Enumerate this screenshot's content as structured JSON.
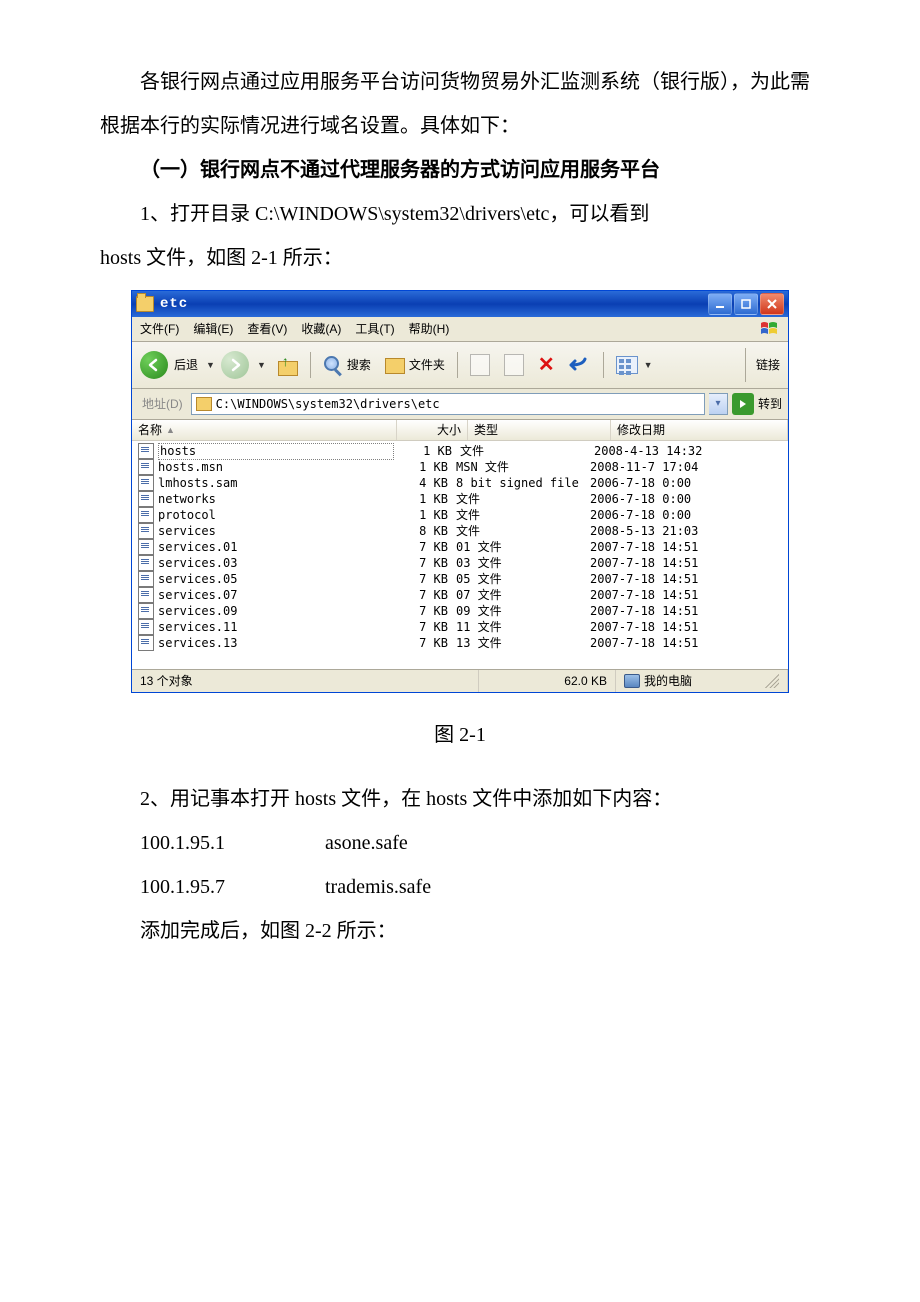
{
  "doc": {
    "p1": "各银行网点通过应用服务平台访问货物贸易外汇监测系统（银行版），为此需根据本行的实际情况进行域名设置。具体如下：",
    "h1": "（一）银行网点不通过代理服务器的方式访问应用服务平台",
    "p2a": "1、打开目录 ",
    "p2b": "C:\\WINDOWS\\system32\\drivers\\etc",
    "p2c": "，可以看到",
    "p2d": "hosts 文件，如图 2-1 所示：",
    "fig1": "图 2-1",
    "p3": "2、用记事本打开 hosts 文件，在 hosts 文件中添加如下内容：",
    "hosts1_ip": "100.1.95.1",
    "hosts1_name": "asone.safe",
    "hosts2_ip": "100.1.95.7",
    "hosts2_name": "trademis.safe",
    "p4": "添加完成后，如图 2-2 所示："
  },
  "explorer": {
    "title": "etc",
    "menu": {
      "file": "文件(F)",
      "edit": "编辑(E)",
      "view": "查看(V)",
      "fav": "收藏(A)",
      "tools": "工具(T)",
      "help": "帮助(H)"
    },
    "toolbar": {
      "back": "后退",
      "search": "搜索",
      "folders": "文件夹",
      "links": "链接"
    },
    "address": {
      "label": "地址(D)",
      "path": "C:\\WINDOWS\\system32\\drivers\\etc",
      "go": "转到"
    },
    "columns": {
      "name": "名称",
      "size": "大小",
      "type": "类型",
      "date": "修改日期"
    },
    "files": [
      {
        "name": "hosts",
        "size": "1 KB",
        "type": "文件",
        "date": "2008-4-13 14:32",
        "selected": true
      },
      {
        "name": "hosts.msn",
        "size": "1 KB",
        "type": "MSN 文件",
        "date": "2008-11-7 17:04"
      },
      {
        "name": "lmhosts.sam",
        "size": "4 KB",
        "type": "8 bit signed file",
        "date": "2006-7-18 0:00"
      },
      {
        "name": "networks",
        "size": "1 KB",
        "type": "文件",
        "date": "2006-7-18 0:00"
      },
      {
        "name": "protocol",
        "size": "1 KB",
        "type": "文件",
        "date": "2006-7-18 0:00"
      },
      {
        "name": "services",
        "size": "8 KB",
        "type": "文件",
        "date": "2008-5-13 21:03"
      },
      {
        "name": "services.01",
        "size": "7 KB",
        "type": "01 文件",
        "date": "2007-7-18 14:51"
      },
      {
        "name": "services.03",
        "size": "7 KB",
        "type": "03 文件",
        "date": "2007-7-18 14:51"
      },
      {
        "name": "services.05",
        "size": "7 KB",
        "type": "05 文件",
        "date": "2007-7-18 14:51"
      },
      {
        "name": "services.07",
        "size": "7 KB",
        "type": "07 文件",
        "date": "2007-7-18 14:51"
      },
      {
        "name": "services.09",
        "size": "7 KB",
        "type": "09 文件",
        "date": "2007-7-18 14:51"
      },
      {
        "name": "services.11",
        "size": "7 KB",
        "type": "11 文件",
        "date": "2007-7-18 14:51"
      },
      {
        "name": "services.13",
        "size": "7 KB",
        "type": "13 文件",
        "date": "2007-7-18 14:51"
      }
    ],
    "status": {
      "objects": "13 个对象",
      "size": "62.0 KB",
      "location": "我的电脑"
    }
  }
}
